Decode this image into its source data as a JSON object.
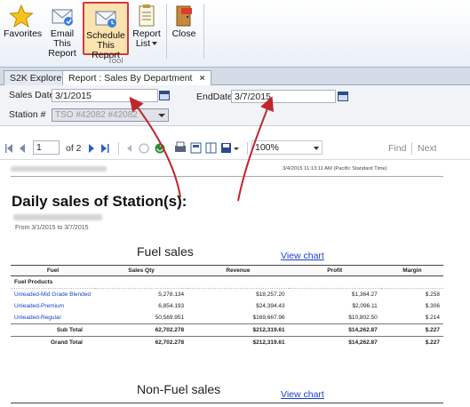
{
  "ribbon": {
    "buttons": [
      {
        "label": "Favorites",
        "icon": "star-icon"
      },
      {
        "label": "Email This Report",
        "icon": "email-icon"
      },
      {
        "label": "Schedule This Report",
        "icon": "schedule-email-icon"
      },
      {
        "label": "Report List",
        "icon": "report-list-icon"
      },
      {
        "label": "Close",
        "icon": "exit-door-icon"
      }
    ],
    "group_label": "Tool"
  },
  "tabs": [
    {
      "label": "S2K Explorer",
      "active": false
    },
    {
      "label": "Report : Sales By Department",
      "active": true,
      "close": "×"
    }
  ],
  "params": {
    "sales_date_label": "Sales Date",
    "sales_date_value": "3/1/2015",
    "end_date_label": "EndDate",
    "end_date_value": "3/7/2015",
    "station_label": "Station #",
    "station_value": "TSO #42082 #42082"
  },
  "viewer_toolbar": {
    "page": "1",
    "of_pages": "of 2",
    "zoom": "100%",
    "find": "Find",
    "next": "Next"
  },
  "report": {
    "printed_time": "3/4/2015 11:13:11 AM (Pacific Standard Time)",
    "title": "Daily sales of Station(s):",
    "range": "From 3/1/2015 to 3/7/2015",
    "fuel_section_title": "Fuel sales",
    "view_chart": "View chart",
    "nonfuel_section_title": "Non-Fuel sales",
    "columns": [
      "Fuel",
      "Sales Qty",
      "Revenue",
      "Profit",
      "Margin"
    ],
    "group": "Fuel Products",
    "rows": [
      {
        "name": "Unleaded-Mid Grade Blended",
        "qty": "5,278.134",
        "revenue": "$18,257.20",
        "profit": "$1,364.27",
        "margin": "$.258"
      },
      {
        "name": "Unleaded-Premium",
        "qty": "6,854.193",
        "revenue": "$24,394.43",
        "profit": "$2,096.11",
        "margin": "$.306"
      },
      {
        "name": "Unleaded-Regular",
        "qty": "50,569.951",
        "revenue": "$169,667.96",
        "profit": "$10,802.50",
        "margin": "$.214"
      }
    ],
    "subtotal": {
      "label": "Sub Total",
      "qty": "62,702.278",
      "revenue": "$212,319.61",
      "profit": "$14,262.87",
      "margin": "$.227"
    },
    "grandtotal": {
      "label": "Grand Total",
      "qty": "62,702.278",
      "revenue": "$212,319.61",
      "profit": "$14,262.87",
      "margin": "$.227"
    }
  },
  "colors": {
    "accent_red": "#c0262d",
    "link_blue": "#1a3fcf",
    "highlight": "#d23a3a"
  }
}
